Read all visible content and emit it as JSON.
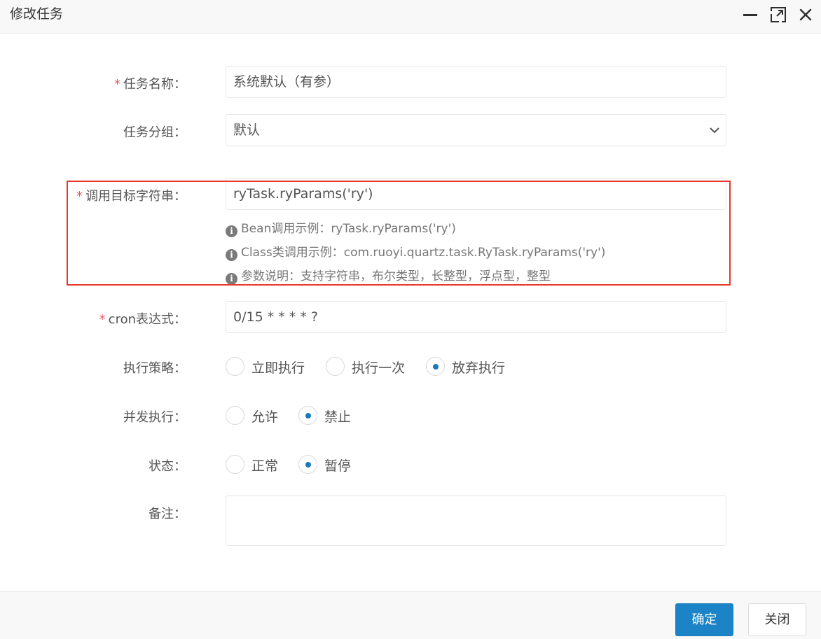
{
  "dialog": {
    "title": "修改任务"
  },
  "form": {
    "job_name": {
      "label": "任务名称：",
      "required_mark": "*",
      "value": "系统默认（有参）"
    },
    "job_group": {
      "label": "任务分组：",
      "selected": "默认"
    },
    "invoke_target": {
      "label": "调用目标字符串：",
      "required_mark": "*",
      "value": "ryTask.ryParams('ry')",
      "hints": [
        "Bean调用示例：ryTask.ryParams('ry')",
        "Class类调用示例：com.ruoyi.quartz.task.RyTask.ryParams('ry')",
        "参数说明：支持字符串，布尔类型，长整型，浮点型，整型"
      ],
      "info_glyph": "i"
    },
    "cron": {
      "label": "cron表达式：",
      "required_mark": "*",
      "value": "0/15 * * * * ?"
    },
    "misfire_policy": {
      "label": "执行策略：",
      "options": [
        "立即执行",
        "执行一次",
        "放弃执行"
      ],
      "selected_index": 2
    },
    "concurrent": {
      "label": "并发执行：",
      "options": [
        "允许",
        "禁止"
      ],
      "selected_index": 1
    },
    "status": {
      "label": "状态：",
      "options": [
        "正常",
        "暂停"
      ],
      "selected_index": 1
    },
    "remark": {
      "label": "备注：",
      "value": ""
    }
  },
  "footer": {
    "confirm_label": "确定",
    "close_label": "关闭"
  },
  "colors": {
    "primary": "#1c84c6",
    "required": "#ed5565",
    "highlight_border": "#e8372a"
  },
  "icons": {
    "minimize": "minimize-icon",
    "maximize": "maximize-icon",
    "close": "close-icon",
    "select_arrow": "chevron-down-icon",
    "hint": "info-circle-icon"
  }
}
